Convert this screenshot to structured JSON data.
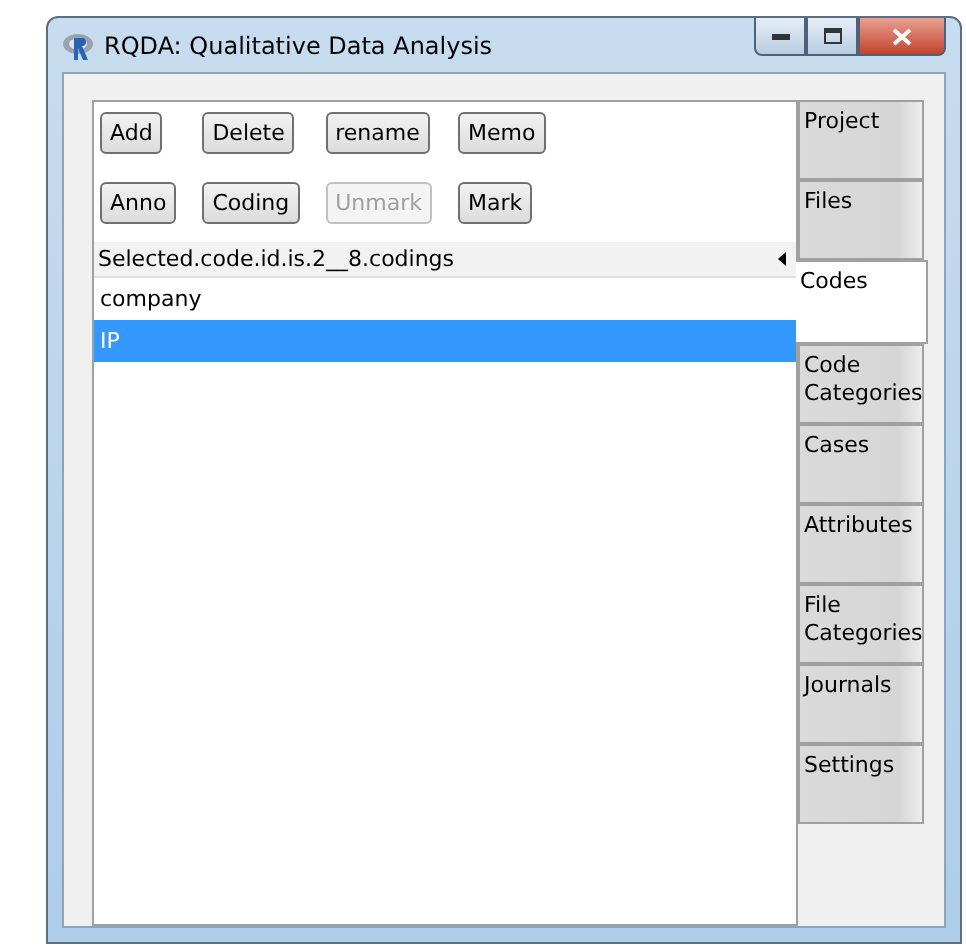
{
  "window": {
    "title": "RQDA: Qualitative Data Analysis"
  },
  "buttons": [
    {
      "label": "Add",
      "disabled": false
    },
    {
      "label": "Delete",
      "disabled": false
    },
    {
      "label": "rename",
      "disabled": false
    },
    {
      "label": "Memo",
      "disabled": false
    },
    {
      "label": "Anno",
      "disabled": false
    },
    {
      "label": "Coding",
      "disabled": false
    },
    {
      "label": "Unmark",
      "disabled": true
    },
    {
      "label": "Mark",
      "disabled": false
    }
  ],
  "list": {
    "header": "Selected.code.id.is.2__8.codings",
    "rows": [
      {
        "label": "company",
        "selected": false
      },
      {
        "label": "IP",
        "selected": true
      }
    ]
  },
  "tabs": [
    {
      "label": "Project",
      "selected": false
    },
    {
      "label": "Files",
      "selected": false
    },
    {
      "label": "Codes",
      "selected": true
    },
    {
      "label": "Code Categories",
      "selected": false
    },
    {
      "label": "Cases",
      "selected": false
    },
    {
      "label": "Attributes",
      "selected": false
    },
    {
      "label": "File Categories",
      "selected": false
    },
    {
      "label": "Journals",
      "selected": false
    },
    {
      "label": "Settings",
      "selected": false
    }
  ]
}
